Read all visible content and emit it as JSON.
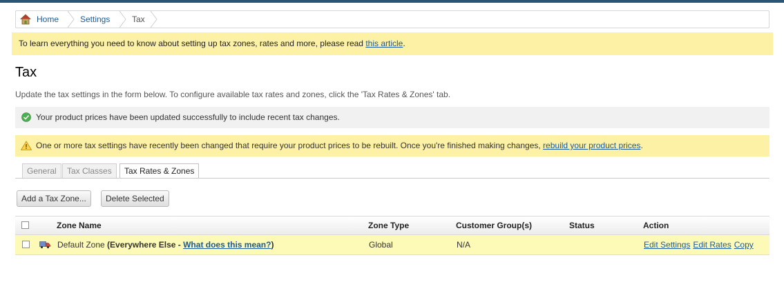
{
  "breadcrumb": {
    "home": "Home",
    "settings": "Settings",
    "current": "Tax"
  },
  "info_bar": {
    "text": "To learn everything you need to know about setting up tax zones, rates and more, please read ",
    "link": "this article",
    "suffix": "."
  },
  "page": {
    "title": "Tax",
    "intro": "Update the tax settings in the form below. To configure available tax rates and zones, click the 'Tax Rates & Zones' tab."
  },
  "messages": {
    "success": "Your product prices have been updated successfully to include recent tax changes.",
    "warning": "One or more tax settings have recently been changed that require your product prices to be rebuilt. Once you're finished making changes, ",
    "warning_link": "rebuild your product prices",
    "warning_suffix": "."
  },
  "tabs": {
    "general": "General",
    "tax_classes": "Tax Classes",
    "tax_rates_zones": "Tax Rates & Zones"
  },
  "buttons": {
    "add_zone": "Add a Tax Zone...",
    "delete_selected": "Delete Selected"
  },
  "table": {
    "headers": {
      "zone_name": "Zone Name",
      "zone_type": "Zone Type",
      "customer_groups": "Customer Group(s)",
      "status": "Status",
      "action": "Action"
    },
    "rows": [
      {
        "name": "Default Zone",
        "paren_open": " (Everywhere Else - ",
        "help_link": "What does this mean?",
        "paren_close": ")",
        "zone_type": "Global",
        "customer_groups": "N/A",
        "status": "",
        "actions": {
          "edit_settings": "Edit Settings",
          "edit_rates": "Edit Rates",
          "copy": "Copy"
        }
      }
    ]
  },
  "colors": {
    "top_bar": "#2a5475",
    "notice_yellow": "#fdf1a6",
    "link": "#1a5a9a",
    "success_green": "#4caf50",
    "warning_orange": "#e0a000"
  }
}
